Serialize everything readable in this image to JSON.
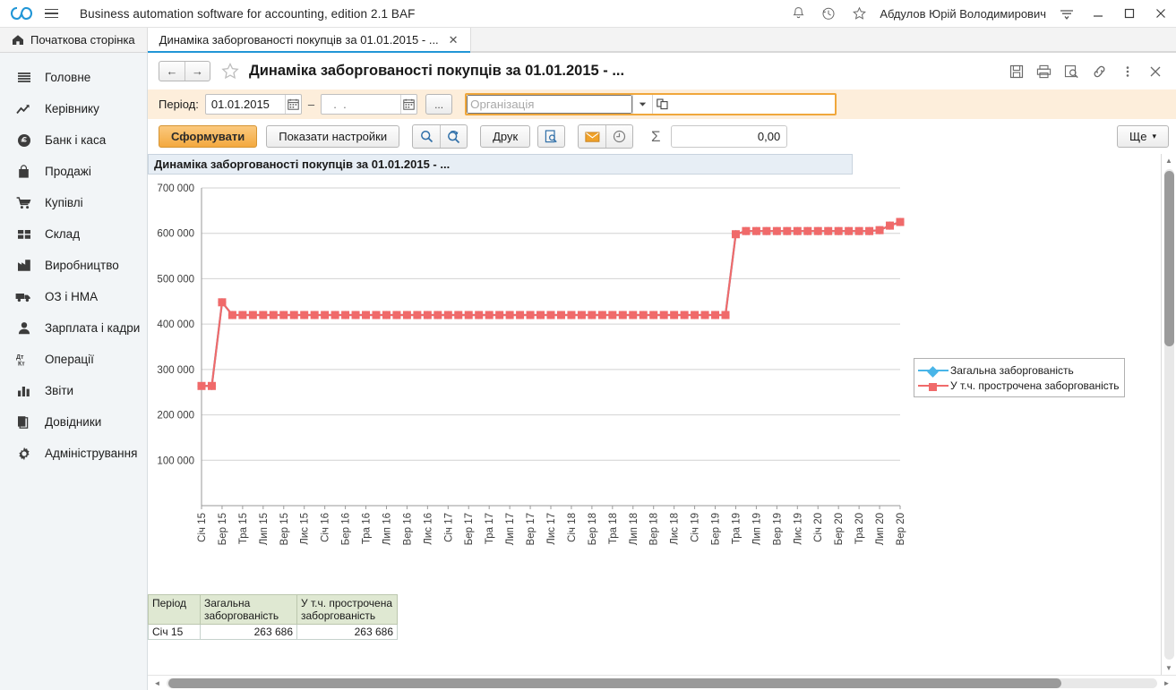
{
  "titlebar": {
    "app_title": "Business automation software for accounting, edition 2.1 BAF",
    "user": "Абдулов Юрій Володимирович",
    "icons": [
      "logo-icon",
      "menu-icon",
      "bell-icon",
      "history-icon",
      "star-icon",
      "menu-lines-icon",
      "minimize-icon",
      "maximize-icon",
      "close-icon"
    ]
  },
  "tabs": [
    {
      "label": "Початкова сторінка",
      "icon": "home-icon",
      "active": false,
      "closable": false
    },
    {
      "label": "Динаміка заборгованості покупців за 01.01.2015 - ...",
      "icon": "",
      "active": true,
      "closable": true
    }
  ],
  "sidebar": {
    "items": [
      {
        "label": "Головне",
        "icon": "list-icon"
      },
      {
        "label": "Керівнику",
        "icon": "trend-icon"
      },
      {
        "label": "Банк і каса",
        "icon": "coin-icon"
      },
      {
        "label": "Продажі",
        "icon": "bag-icon"
      },
      {
        "label": "Купівлі",
        "icon": "cart-icon"
      },
      {
        "label": "Склад",
        "icon": "grid-icon"
      },
      {
        "label": "Виробництво",
        "icon": "factory-icon"
      },
      {
        "label": "ОЗ і НМА",
        "icon": "truck-icon"
      },
      {
        "label": "Зарплата і кадри",
        "icon": "person-icon"
      },
      {
        "label": "Операції",
        "icon": "debit-credit-icon"
      },
      {
        "label": "Звіти",
        "icon": "bar-chart-icon"
      },
      {
        "label": "Довідники",
        "icon": "books-icon"
      },
      {
        "label": "Адміністрування",
        "icon": "gear-icon"
      }
    ]
  },
  "report_header": {
    "back_label": "←",
    "forward_label": "→",
    "favorite_icon": "star-outline-icon",
    "title": "Динаміка заборгованості покупців за 01.01.2015 - ...",
    "actions": [
      "save-icon",
      "print-icon",
      "preview-icon",
      "link-icon",
      "more-icon",
      "close-icon"
    ]
  },
  "period_bar": {
    "label": "Період:",
    "date_from": "01.01.2015",
    "date_to_placeholder": "  .  .",
    "date_to": "",
    "calendar_icon": "calendar-icon",
    "ellipsis_label": "...",
    "org_placeholder": "Організація",
    "org_value": "",
    "dropdown_icon": "chevron-down-icon",
    "open_icon": "open-window-icon",
    "dash": "–"
  },
  "toolbar": {
    "generate_label": "Сформувати",
    "settings_label": "Показати настройки",
    "find_icon": "search-icon",
    "find_cancel_icon": "search-cancel-icon",
    "print_label": "Друк",
    "preview_icon": "print-preview-icon",
    "mail_icon": "mail-icon",
    "schedule_icon": "clock-icon",
    "sum_icon": "sigma-icon",
    "sum_value": "0,00",
    "more_label": "Ще",
    "more_caret": "▾"
  },
  "report": {
    "chart_title": "Динаміка заборгованості покупців за 01.01.2015 - ...",
    "table": {
      "columns": [
        "Період",
        "Загальна заборгованість",
        "У т.ч. прострочена заборгованість"
      ],
      "rows": [
        [
          "Січ 15",
          "263 686",
          "263 686"
        ]
      ]
    }
  },
  "chart_data": {
    "type": "line",
    "title": "Динаміка заборгованості покупців за 01.01.2015 - ...",
    "xlabel": "",
    "ylabel": "",
    "ylim": [
      0,
      700000
    ],
    "yticks": [
      100000,
      200000,
      300000,
      400000,
      500000,
      600000,
      700000
    ],
    "ytick_labels": [
      "100 000",
      "200 000",
      "300 000",
      "400 000",
      "500 000",
      "600 000",
      "700 000"
    ],
    "grid": true,
    "legend_position": "right",
    "x": [
      "Січ 15",
      "Лют 15",
      "Бер 15",
      "Кві 15",
      "Тра 15",
      "Чер 15",
      "Лип 15",
      "Сер 15",
      "Вер 15",
      "Жов 15",
      "Лис 15",
      "Гру 15",
      "Січ 16",
      "Лют 16",
      "Бер 16",
      "Кві 16",
      "Тра 16",
      "Чер 16",
      "Лип 16",
      "Сер 16",
      "Вер 16",
      "Жов 16",
      "Лис 16",
      "Гру 16",
      "Січ 17",
      "Лют 17",
      "Бер 17",
      "Кві 17",
      "Тра 17",
      "Чер 17",
      "Лип 17",
      "Сер 17",
      "Вер 17",
      "Жов 17",
      "Лис 17",
      "Гру 17",
      "Січ 18",
      "Лют 18",
      "Бер 18",
      "Кві 18",
      "Тра 18",
      "Чер 18",
      "Лип 18",
      "Сер 18",
      "Вер 18",
      "Жов 18",
      "Лис 18",
      "Гру 18",
      "Січ 19",
      "Лют 19",
      "Бер 19",
      "Кві 19",
      "Тра 19",
      "Чер 19",
      "Лип 19",
      "Сер 19",
      "Вер 19",
      "Жов 19",
      "Лис 19",
      "Гру 19",
      "Січ 20",
      "Лют 20",
      "Бер 20",
      "Кві 20",
      "Тра 20",
      "Чер 20",
      "Лип 20",
      "Сер 20",
      "Вер 20"
    ],
    "xtick_labels": [
      "Січ 15",
      "Бер 15",
      "Тра 15",
      "Лип 15",
      "Вер 15",
      "Лис 15",
      "Січ 16",
      "Бер 16",
      "Тра 16",
      "Лип 16",
      "Вер 16",
      "Лис 16",
      "Січ 17",
      "Бер 17",
      "Тра 17",
      "Лип 17",
      "Вер 17",
      "Лис 17",
      "Січ 18",
      "Бер 18",
      "Тра 18",
      "Лип 18",
      "Вер 18",
      "Лис 18",
      "Січ 19",
      "Бер 19",
      "Тра 19",
      "Лип 19",
      "Вер 19",
      "Лис 19",
      "Січ 20",
      "Бер 20",
      "Тра 20",
      "Лип 20",
      "Вер 20"
    ],
    "series": [
      {
        "name": "Загальна заборгованість",
        "color": "#49b5e8",
        "marker": "diamond",
        "values": [
          263686,
          263686,
          448000,
          420000,
          420000,
          420000,
          420000,
          420000,
          420000,
          420000,
          420000,
          420000,
          420000,
          420000,
          420000,
          420000,
          420000,
          420000,
          420000,
          420000,
          420000,
          420000,
          420000,
          420000,
          420000,
          420000,
          420000,
          420000,
          420000,
          420000,
          420000,
          420000,
          420000,
          420000,
          420000,
          420000,
          420000,
          420000,
          420000,
          420000,
          420000,
          420000,
          420000,
          420000,
          420000,
          420000,
          420000,
          420000,
          420000,
          420000,
          420000,
          420000,
          598000,
          605000,
          605000,
          605000,
          605000,
          605000,
          605000,
          605000,
          605000,
          605000,
          605000,
          605000,
          605000,
          605000,
          607000,
          617000,
          625000
        ]
      },
      {
        "name": "У т.ч. прострочена заборгованість",
        "color": "#f06a6a",
        "marker": "square",
        "values": [
          263686,
          263686,
          448000,
          420000,
          420000,
          420000,
          420000,
          420000,
          420000,
          420000,
          420000,
          420000,
          420000,
          420000,
          420000,
          420000,
          420000,
          420000,
          420000,
          420000,
          420000,
          420000,
          420000,
          420000,
          420000,
          420000,
          420000,
          420000,
          420000,
          420000,
          420000,
          420000,
          420000,
          420000,
          420000,
          420000,
          420000,
          420000,
          420000,
          420000,
          420000,
          420000,
          420000,
          420000,
          420000,
          420000,
          420000,
          420000,
          420000,
          420000,
          420000,
          420000,
          598000,
          605000,
          605000,
          605000,
          605000,
          605000,
          605000,
          605000,
          605000,
          605000,
          605000,
          605000,
          605000,
          605000,
          607000,
          617000,
          625000
        ]
      }
    ]
  },
  "scrollbars": {
    "vertical": {
      "up": "▲",
      "down": "▼"
    },
    "horizontal": {
      "left": "◄",
      "right": "►"
    }
  }
}
